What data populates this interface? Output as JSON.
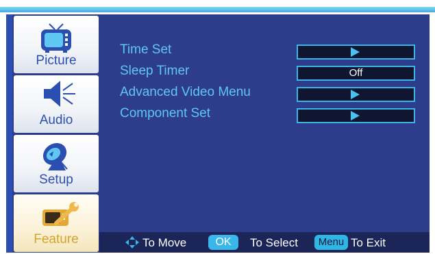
{
  "sidebar": {
    "items": [
      {
        "label": "Picture",
        "icon": "tv-icon"
      },
      {
        "label": "Audio",
        "icon": "speaker-icon"
      },
      {
        "label": "Setup",
        "icon": "satellite-dish-icon"
      },
      {
        "label": "Feature",
        "icon": "wrench-icon",
        "active": true
      }
    ]
  },
  "menu": {
    "items": [
      {
        "label": "Time Set",
        "control": "arrow"
      },
      {
        "label": "Sleep Timer",
        "control": "value",
        "value": "Off"
      },
      {
        "label": "Advanced Video Menu",
        "control": "arrow"
      },
      {
        "label": "Component Set",
        "control": "arrow"
      }
    ]
  },
  "footer": {
    "move_label": "To Move",
    "ok_key": "OK",
    "select_label": "To Select",
    "menu_key": "Menu",
    "exit_label": "To Exit"
  },
  "colors": {
    "panel_bg": "#2d3d8b",
    "accent": "#3ab6e8",
    "menu_text": "#5fc7f2",
    "active_tab_text": "#d6a32a"
  }
}
